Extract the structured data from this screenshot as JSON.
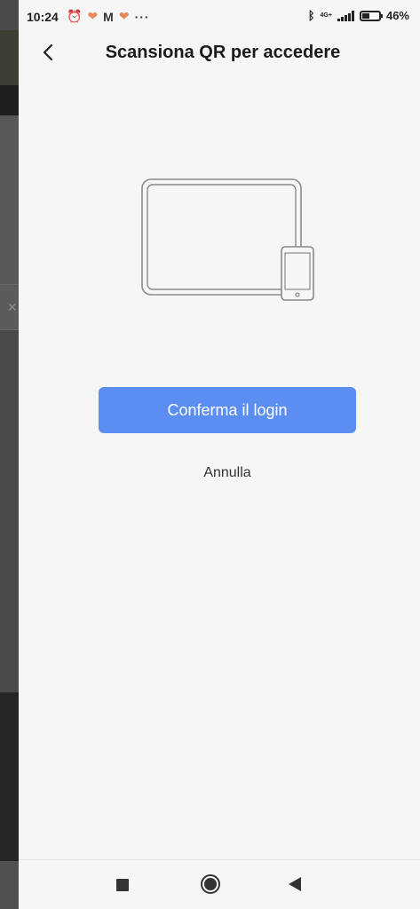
{
  "status_bar": {
    "time": "10:24",
    "battery_percent": "46%",
    "battery_level": 0.46,
    "network": "4G+",
    "icons_left": [
      "alarm-icon",
      "heart-icon",
      "gmail-icon",
      "heart-icon",
      "more-icon"
    ],
    "icons_right": [
      "bluetooth-icon",
      "signal-icon",
      "battery-icon"
    ]
  },
  "header": {
    "title": "Scansiona QR per accedere",
    "back_icon": "chevron-left-icon"
  },
  "illustration": {
    "icon": "tablet-and-phone-icon"
  },
  "actions": {
    "confirm_label": "Conferma il login",
    "cancel_label": "Annulla"
  },
  "colors": {
    "accent": "#5b8ef0",
    "background": "#f6f6f6",
    "text": "#1b1b1b"
  },
  "nav_bar": {
    "icons": [
      "recents-icon",
      "home-icon",
      "back-icon"
    ]
  }
}
